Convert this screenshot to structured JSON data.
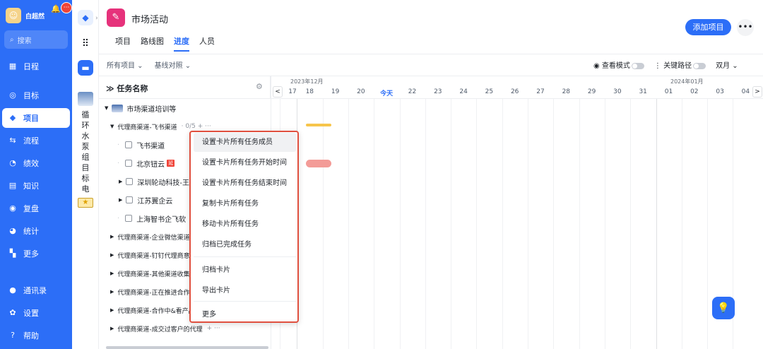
{
  "sidebar": {
    "username": "白超然",
    "badge": "···",
    "search_label": "搜索",
    "items": [
      {
        "label": "日程",
        "icon": "calendar-icon",
        "glyph": "▦"
      },
      {
        "label": "目标",
        "icon": "target-icon",
        "glyph": "◎"
      },
      {
        "label": "项目",
        "icon": "cube-icon",
        "glyph": "◆"
      },
      {
        "label": "流程",
        "icon": "flow-icon",
        "glyph": "⇆"
      },
      {
        "label": "绩效",
        "icon": "chart-icon",
        "glyph": "◔"
      },
      {
        "label": "知识",
        "icon": "book-icon",
        "glyph": "▤"
      },
      {
        "label": "复盘",
        "icon": "review-icon",
        "glyph": "◉"
      },
      {
        "label": "统计",
        "icon": "pie-icon",
        "glyph": "◕"
      },
      {
        "label": "更多",
        "icon": "grid-icon",
        "glyph": "▚"
      },
      {
        "label": "通讯录",
        "icon": "contacts-icon",
        "glyph": "●"
      },
      {
        "label": "设置",
        "icon": "settings-icon",
        "glyph": "✿"
      },
      {
        "label": "帮助",
        "icon": "help-icon",
        "glyph": "?"
      }
    ]
  },
  "second_col": {
    "vertical_text": "循环水泵组目标电"
  },
  "header": {
    "project_title": "市场活动",
    "tabs": [
      "项目",
      "路线图",
      "进度",
      "人员"
    ],
    "active_tab": "进度",
    "add_button": "添加项目",
    "more_glyph": "•••"
  },
  "toolbar": {
    "all_projects": "所有项目 ⌄",
    "baseline": "基线对照 ⌄",
    "view_mode": "查看模式",
    "critical_path": "关键路径",
    "period": "双月 ⌄"
  },
  "task_list": {
    "header": "任务名称",
    "rows": [
      {
        "level": 0,
        "label": "市场渠道培训等",
        "type": "group"
      },
      {
        "level": 1,
        "label": "代理商渠道-飞书渠道",
        "extra": "· 0/5  +  ···",
        "type": "sub"
      },
      {
        "level": 2,
        "label": "飞书渠道",
        "type": "task"
      },
      {
        "level": 2,
        "label": "北京钮云",
        "delay": "延",
        "type": "task"
      },
      {
        "level": 2,
        "label": "深圳轮动科技-王",
        "type": "task-expand"
      },
      {
        "level": 2,
        "label": "江苏翼企云",
        "type": "task-expand"
      },
      {
        "level": 2,
        "label": "上海智书企飞软",
        "type": "task"
      },
      {
        "level": 1,
        "label": "代理商渠道-企业微信渠道",
        "type": "sub"
      },
      {
        "level": 1,
        "label": "代理商渠道-钉钉代理商意",
        "type": "sub"
      },
      {
        "level": 1,
        "label": "代理商渠道-其他渠道收集",
        "type": "sub"
      },
      {
        "level": 1,
        "label": "代理商渠道-正在推进合作",
        "type": "sub"
      },
      {
        "level": 1,
        "label": "代理商渠道-合作中&看产品",
        "type": "sub"
      },
      {
        "level": 1,
        "label": "代理商渠道-成交过客户的代理",
        "extra": "+  ···",
        "type": "sub"
      }
    ]
  },
  "gantt": {
    "month_dec": "2023年12月",
    "month_jan": "2024年01月",
    "days": [
      "17",
      "18",
      "19",
      "20",
      "今天",
      "22",
      "23",
      "24",
      "25",
      "26",
      "27",
      "28",
      "29",
      "30",
      "31",
      "01",
      "02",
      "03",
      "04"
    ],
    "nav_prev": "<",
    "nav_next": ">"
  },
  "context_menu": {
    "items": [
      "设置卡片所有任务成员",
      "设置卡片所有任务开始时间",
      "设置卡片所有任务结束时间",
      "复制卡片所有任务",
      "移动卡片所有任务",
      "归档已完成任务",
      "归档卡片",
      "导出卡片",
      "更多"
    ]
  },
  "colors": {
    "primary": "#2c6ef7",
    "menu_border": "#e0503f",
    "bar_yellow": "#f7c54b",
    "bar_red": "#f39b97"
  }
}
